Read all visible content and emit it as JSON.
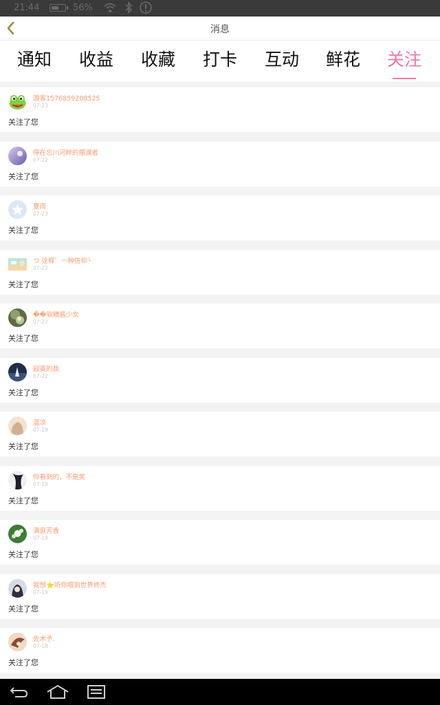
{
  "status_bar": {
    "time": "21:44",
    "battery_pct": "56%",
    "battery_level": 0.56
  },
  "header": {
    "title": "消息"
  },
  "tabs": [
    {
      "label": "通知",
      "active": false
    },
    {
      "label": "收益",
      "active": false
    },
    {
      "label": "收藏",
      "active": false
    },
    {
      "label": "打卡",
      "active": false
    },
    {
      "label": "互动",
      "active": false
    },
    {
      "label": "鲜花",
      "active": false
    },
    {
      "label": "关注",
      "active": true
    }
  ],
  "notifications": [
    {
      "username": "游客1576859208525",
      "date": "07-23",
      "message": "关注了您"
    },
    {
      "username": "停在忘川河畔的摆渡者",
      "date": "07-22",
      "message": "关注了您"
    },
    {
      "username": "夏雨",
      "date": "07-23",
      "message": "关注了您"
    },
    {
      "username": "つ  诠释゛一种信仰╰",
      "date": "07-22",
      "message": "关注了您"
    },
    {
      "username": "��软糖酱少女",
      "date": "07-22",
      "message": "关注了您"
    },
    {
      "username": "寂寞的我",
      "date": "07-22",
      "message": "关注了您"
    },
    {
      "username": "温凉",
      "date": "07-19",
      "message": "关注了您"
    },
    {
      "username": "你看到的，不是笑",
      "date": "07-19",
      "message": "关注了您"
    },
    {
      "username": "满庭芳香",
      "date": "07-19",
      "message": "关注了您"
    },
    {
      "username": "我想⭐听你唱到世界终杰",
      "date": "07-19",
      "message": "关注了您"
    },
    {
      "username": "佐木予.",
      "date": "07-18",
      "message": "关注了您"
    }
  ],
  "colors": {
    "accent": "#ee77aa",
    "username": "#ff9a6e",
    "date": "#c8c8c8",
    "message": "#333333",
    "background": "#f3f3f3"
  },
  "icons": {
    "back": "chevron-left-icon",
    "wifi": "wifi-icon",
    "bluetooth": "bluetooth-icon",
    "alert": "alert-icon",
    "nav_back": "back-arrow-icon",
    "nav_home": "home-icon",
    "nav_menu": "menu-icon"
  }
}
